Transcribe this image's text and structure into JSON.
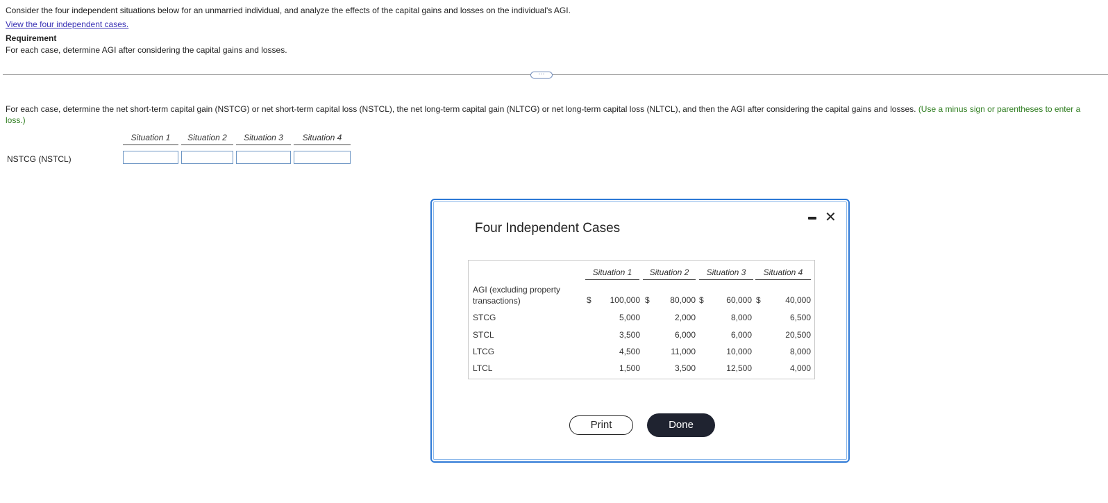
{
  "question": {
    "intro": "Consider the four independent situations below for an unmarried individual, and analyze the effects of the capital gains and losses on the individual's AGI.",
    "link_text": "View the four independent cases.",
    "requirement_title": "Requirement",
    "requirement_text": "For each case, determine AGI after considering the capital gains and losses.",
    "more_button": "⋯"
  },
  "instruction": {
    "text": "For each case, determine the net short-term capital gain (NSTCG) or net short-term capital loss (NSTCL), the net long-term capital gain (NLTCG) or net long-term capital loss (NLTCL), and then the AGI after considering the capital gains and losses.",
    "hint": "(Use a minus sign or parentheses to enter a loss.)"
  },
  "answer_table": {
    "columns": [
      "Situation 1",
      "Situation 2",
      "Situation 3",
      "Situation 4"
    ],
    "row_label": "NSTCG (NSTCL)",
    "values": [
      "",
      "",
      "",
      ""
    ]
  },
  "modal": {
    "title": "Four Independent Cases",
    "minimize_icon": "minimize-icon",
    "close_icon": "✕",
    "columns": [
      "Situation 1",
      "Situation 2",
      "Situation 3",
      "Situation 4"
    ],
    "rows": [
      {
        "label": "AGI (excluding property transactions)",
        "currency": "$",
        "values": [
          "100,000",
          "80,000",
          "60,000",
          "40,000"
        ]
      },
      {
        "label": "STCG",
        "currency": "",
        "values": [
          "5,000",
          "2,000",
          "8,000",
          "6,500"
        ]
      },
      {
        "label": "STCL",
        "currency": "",
        "values": [
          "3,500",
          "6,000",
          "6,000",
          "20,500"
        ]
      },
      {
        "label": "LTCG",
        "currency": "",
        "values": [
          "4,500",
          "11,000",
          "10,000",
          "8,000"
        ]
      },
      {
        "label": "LTCL",
        "currency": "",
        "values": [
          "1,500",
          "3,500",
          "12,500",
          "4,000"
        ]
      }
    ],
    "print_label": "Print",
    "done_label": "Done"
  },
  "colors": {
    "link": "#3b33b5",
    "hint_green": "#2e7d1f",
    "modal_border": "#2e79d6",
    "done_button": "#1f2330",
    "input_border": "#6d96c4"
  }
}
